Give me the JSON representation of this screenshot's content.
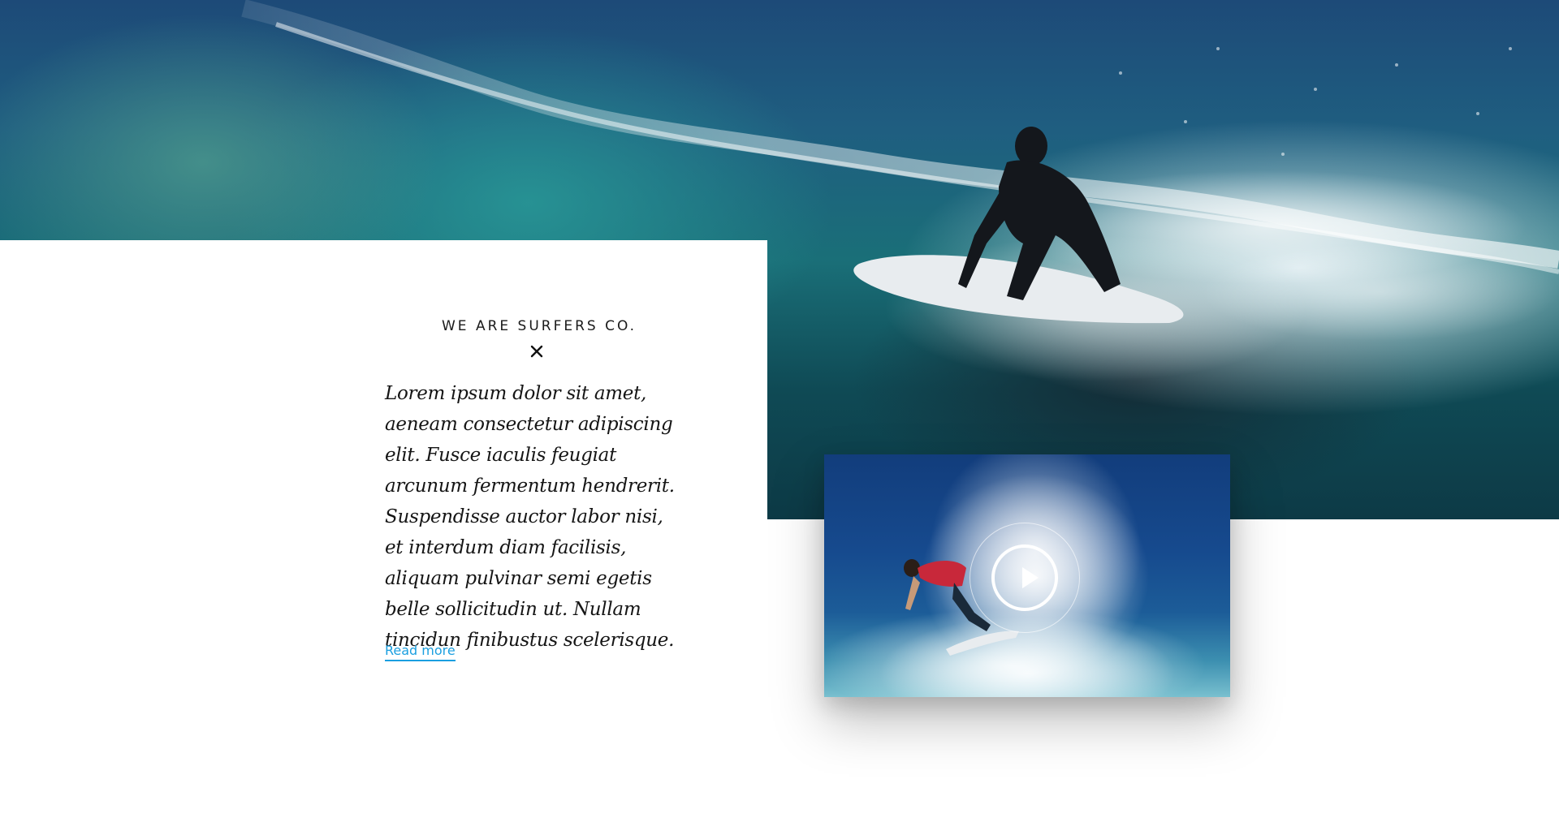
{
  "section": {
    "kicker": "WE ARE SURFERS CO.",
    "divider_icon": "close-x-icon",
    "body": "Lorem ipsum dolor sit amet, aeneam consectetur adipiscing elit. Fusce iaculis feugiat arcunum fermentum hendrerit. Suspendisse auctor labor nisi, et interdum diam facilisis, aliquam pulvinar semi egetis belle sollicitudin ut. Nullam tincidun finibustus scelerisque.",
    "read_more_label": "Read more"
  },
  "media": {
    "hero_image": "surfer-riding-wave-photo",
    "video_thumbnail": "surfer-in-spray-photo",
    "play_icon": "play-icon"
  },
  "colors": {
    "link": "#1a9fe0",
    "text": "#151515",
    "background": "#ffffff"
  }
}
